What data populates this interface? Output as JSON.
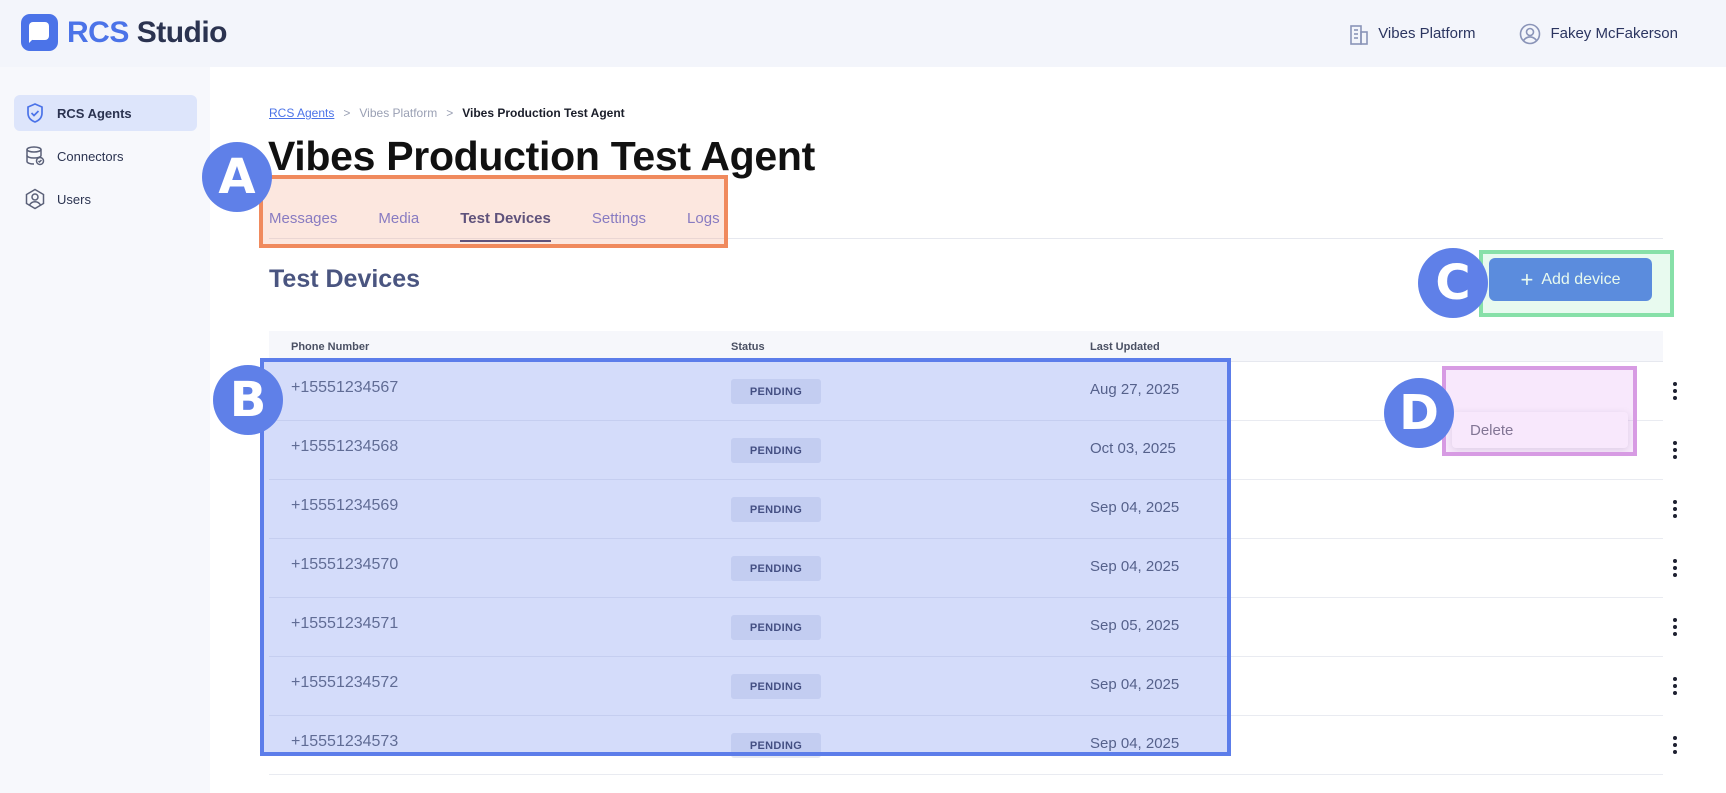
{
  "brand": {
    "name_part1": "RCS",
    "name_part2": "Studio"
  },
  "header": {
    "org_label": "Vibes Platform",
    "user_label": "Fakey McFakerson"
  },
  "sidebar": {
    "items": [
      {
        "label": "RCS Agents",
        "icon": "shield-check-icon",
        "active": true
      },
      {
        "label": "Connectors",
        "icon": "database-icon",
        "active": false
      },
      {
        "label": "Users",
        "icon": "user-icon",
        "active": false
      }
    ]
  },
  "breadcrumb": {
    "items": [
      "RCS Agents",
      "Vibes Platform",
      "Vibes Production Test Agent"
    ],
    "separator": ">"
  },
  "page": {
    "title": "Vibes Production Test Agent"
  },
  "tabs": [
    {
      "label": "Messages",
      "active": false
    },
    {
      "label": "Media",
      "active": false
    },
    {
      "label": "Test Devices",
      "active": true
    },
    {
      "label": "Settings",
      "active": false
    },
    {
      "label": "Logs",
      "active": false
    }
  ],
  "section": {
    "title": "Test Devices",
    "add_button_label": "Add device",
    "add_button_icon": "plus-icon"
  },
  "table": {
    "columns": [
      "Phone Number",
      "Status",
      "Last Updated"
    ],
    "rows": [
      {
        "phone": "+15551234567",
        "status": "PENDING",
        "updated": "Aug 27, 2025"
      },
      {
        "phone": "+15551234568",
        "status": "PENDING",
        "updated": "Oct 03, 2025"
      },
      {
        "phone": "+15551234569",
        "status": "PENDING",
        "updated": "Sep 04, 2025"
      },
      {
        "phone": "+15551234570",
        "status": "PENDING",
        "updated": "Sep 04, 2025"
      },
      {
        "phone": "+15551234571",
        "status": "PENDING",
        "updated": "Sep 05, 2025"
      },
      {
        "phone": "+15551234572",
        "status": "PENDING",
        "updated": "Sep 04, 2025"
      },
      {
        "phone": "+15551234573",
        "status": "PENDING",
        "updated": "Sep 04, 2025"
      }
    ]
  },
  "row_menu": {
    "delete_label": "Delete"
  },
  "annotations": {
    "labels": [
      "A",
      "B",
      "C",
      "D"
    ]
  },
  "colors": {
    "accent": "#4b73e8",
    "tab_active": "#263175",
    "highlight_a": "#f08a5d",
    "highlight_b": "#5c7dea",
    "highlight_c": "#87e0a8",
    "highlight_d": "#d79be3",
    "marker": "#5f80e8"
  }
}
